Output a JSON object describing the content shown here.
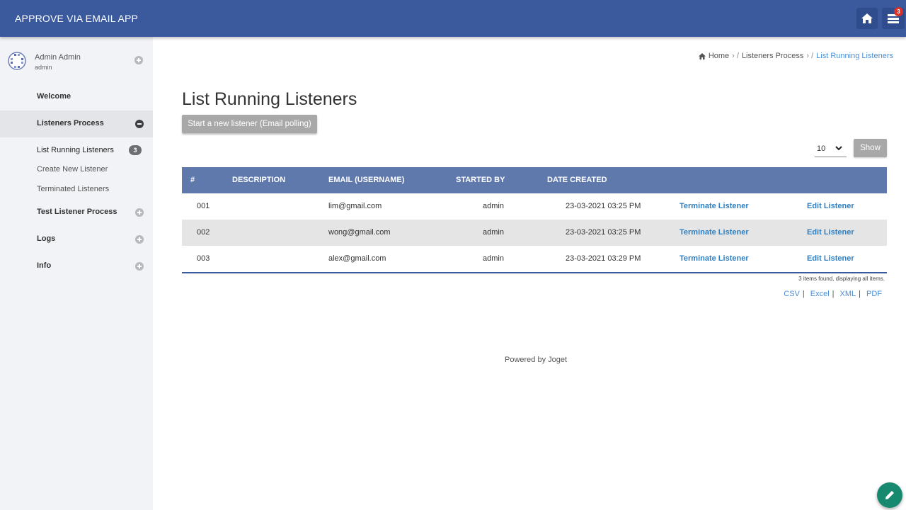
{
  "header": {
    "app_title": "APPROVE VIA EMAIL APP",
    "inbox_count": "3",
    "home_icon": "home-icon",
    "inbox_icon": "inbox-icon"
  },
  "sidebar": {
    "user": {
      "name": "Admin Admin",
      "role": "admin"
    },
    "items": [
      {
        "label": "Welcome"
      },
      {
        "label": "Listeners Process",
        "expanded": true
      },
      {
        "label": "Test Listener Process"
      },
      {
        "label": "Logs"
      },
      {
        "label": "Info"
      }
    ],
    "subitems": [
      {
        "label": "List Running Listeners",
        "badge": "3"
      },
      {
        "label": "Create New Listener"
      },
      {
        "label": "Terminated Listeners"
      }
    ]
  },
  "breadcrumb": {
    "home": "Home",
    "parent": "Listeners Process",
    "current": "List Running Listeners"
  },
  "page": {
    "title": "List Running Listeners",
    "start_button": "Start a new listener (Email polling)",
    "page_size": "10",
    "show_button": "Show"
  },
  "table": {
    "columns": [
      "#",
      "DESCRIPTION",
      "EMAIL (USERNAME)",
      "STARTED BY",
      "DATE CREATED"
    ],
    "rows": [
      {
        "id": "001",
        "description": "",
        "email": "lim@gmail.com",
        "started_by": "admin",
        "date": "23-03-2021 03:25 PM",
        "terminate": "Terminate Listener",
        "edit": "Edit Listener"
      },
      {
        "id": "002",
        "description": "",
        "email": "wong@gmail.com",
        "started_by": "admin",
        "date": "23-03-2021 03:25 PM",
        "terminate": "Terminate Listener",
        "edit": "Edit Listener"
      },
      {
        "id": "003",
        "description": "",
        "email": "alex@gmail.com",
        "started_by": "admin",
        "date": "23-03-2021 03:29 PM",
        "terminate": "Terminate Listener",
        "edit": "Edit Listener"
      }
    ],
    "found_text": "3 items found, displaying all items.",
    "exports": [
      "CSV",
      "Excel",
      "XML",
      "PDF"
    ]
  },
  "footer": {
    "powered": "Powered by Joget"
  },
  "colors": {
    "header": "#3b5a9e",
    "table_header": "#6079ad",
    "link": "#2f7fc1",
    "fab": "#17896f"
  }
}
